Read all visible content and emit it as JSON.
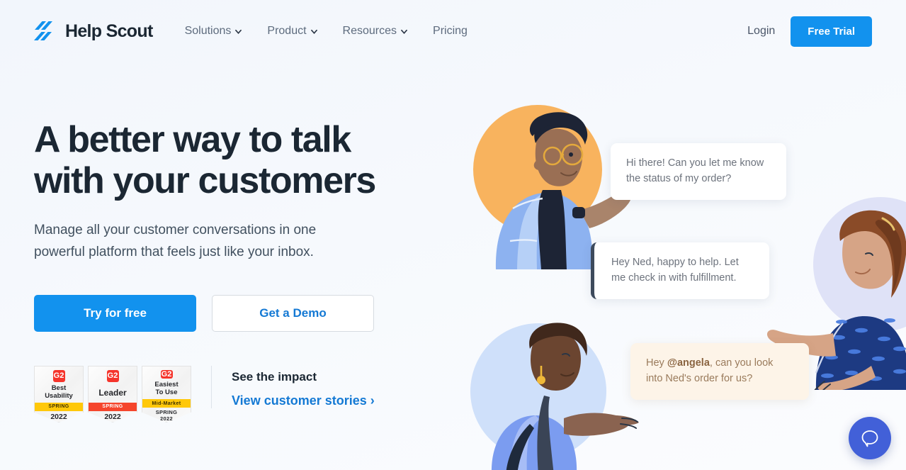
{
  "header": {
    "logo": {
      "text": "Help Scout",
      "mark_icon": "helpscout-logo-icon",
      "color": "#1292ee"
    },
    "nav": [
      {
        "label": "Solutions",
        "has_dropdown": true
      },
      {
        "label": "Product",
        "has_dropdown": true
      },
      {
        "label": "Resources",
        "has_dropdown": true
      },
      {
        "label": "Pricing",
        "has_dropdown": false
      }
    ],
    "login_label": "Login",
    "free_trial_label": "Free Trial"
  },
  "hero": {
    "headline_line1": "A better way to talk",
    "headline_line2": "with your customers",
    "subheadline": "Manage all your customer conversations in one powerful platform that feels just like your inbox.",
    "primary_cta": "Try for free",
    "secondary_cta": "Get a Demo"
  },
  "badges": [
    {
      "award": "G2",
      "title_line1": "Best",
      "title_line2": "Usability",
      "band": "SPRING",
      "band_color": "#ffc80a",
      "year_line1": "2022",
      "year_line2": ""
    },
    {
      "award": "G2",
      "title_line1": "Leader",
      "title_line2": "",
      "band": "SPRING",
      "band_color": "#f5452c",
      "year_line1": "2022",
      "year_line2": ""
    },
    {
      "award": "G2",
      "title_line1": "Easiest",
      "title_line2": "To Use",
      "band": "Mid-Market",
      "band_color": "#ffc80a",
      "year_line1": "SPRING",
      "year_line2": "2022"
    }
  ],
  "impact": {
    "title": "See the impact",
    "link_label": "View customer stories ›"
  },
  "illustration": {
    "bubbles": [
      {
        "id": "bubble-customer",
        "line1": "Hi there! Can you let me know",
        "line2": "the status of my order?",
        "style": "plain"
      },
      {
        "id": "bubble-agent",
        "line1": "Hey Ned, happy to help. Let",
        "line2": "me check in with fulfillment.",
        "style": "accent"
      },
      {
        "id": "bubble-mention",
        "line1_pre": "Hey ",
        "mention": "@angela",
        "line1_post": ", can you look",
        "line2": "into Ned's order for us?",
        "style": "cream"
      }
    ],
    "people": [
      {
        "id": "person-agent-glasses",
        "circle_color": "#f8b35e"
      },
      {
        "id": "person-teammate-bob",
        "circle_color": "#dfe2f7"
      },
      {
        "id": "person-customer",
        "circle_color": "#cfe0fa"
      }
    ]
  },
  "chat_widget": {
    "icon": "chat-bubble-icon",
    "color": "#4260d8"
  }
}
